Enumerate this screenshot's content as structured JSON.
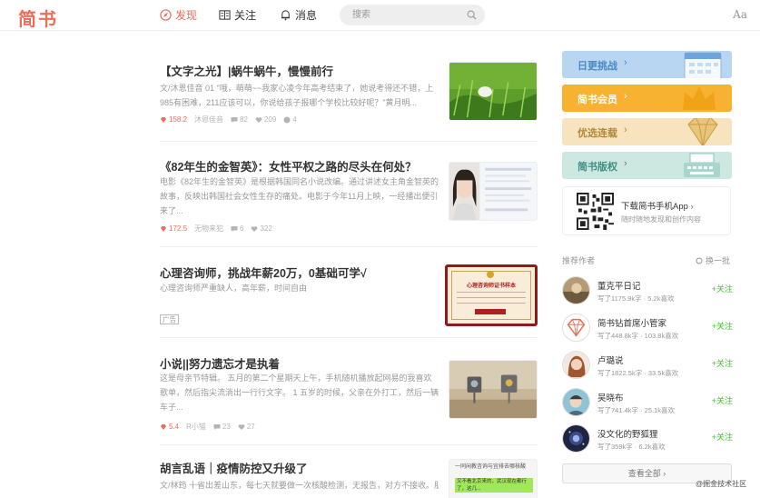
{
  "header": {
    "logo": "简书",
    "nav": [
      {
        "label": "发现"
      },
      {
        "label": "关注"
      },
      {
        "label": "消息"
      }
    ],
    "search_placeholder": "搜索",
    "aa_label": "Aa"
  },
  "articles": [
    {
      "title": "【文字之光】|蜗牛蜗牛，慢慢前行",
      "abstract": "文/沐恩佳音 01 \"哦，萌萌~~我家心凌今年高考结束了，她说考得还不错，上985有困难，211应该可以，你说给孩子报哪个学校比较好呢？\"黄月明...",
      "jsd": "158.2",
      "author": "沐恩佳音",
      "comments": "82",
      "likes": "209",
      "rewards": "4"
    },
    {
      "title": "《82年生的金智英》：女性平权之路的尽头在何处？",
      "abstract": "电影《82年生的金智英》是根据韩国同名小说改编。通过讲述女主角金智英的故事，反映出韩国社会女性生存的痛处。电影于今年11月上映，一经播出便引来了...",
      "jsd": "172.5",
      "author": "无物来犯",
      "comments": "6",
      "likes": "322"
    },
    {
      "title": "心理咨询师，挑战年薪20万，0基础可学√",
      "abstract": "心理咨询师严重缺人，高年薪，时间自由",
      "ad_tag": "广告",
      "cert_text": "心理咨询师证书样本"
    },
    {
      "title": "小说||努力遗忘才是执着",
      "abstract": "这是母亲节特辑。 五月的第二个星期天上午，手机随机播放起网易的我喜欢歌单，然后指尖流淌出一行行文字。 1 五岁的时候，父亲在外打工，然后一辆车子...",
      "jsd": "5.4",
      "author": "R小猫",
      "comments": "23",
      "likes": "27"
    },
    {
      "title": "胡言乱语｜疫情防控又升级了",
      "abstract": "文/林筠 十省出差山东，每七天就要做一次核酸检测，无报告，对方不接收。朋",
      "thumb_text_1": "一同闲教咨询与宜排去哪核酸",
      "thumb_text_2": "又不看北京来的，武汉现在都行了，这几..."
    }
  ],
  "sidebar": {
    "banners": [
      {
        "label": "日更挑战",
        "color": "#4a88c6"
      },
      {
        "label": "简书会员",
        "color": "#ffffff"
      },
      {
        "label": "优选连载",
        "color": "#b0883b"
      },
      {
        "label": "简书版权",
        "color": "#3e8f83"
      }
    ],
    "app_title": "下载简书手机App",
    "app_subtitle": "随时随地发现和创作内容",
    "recommended_title": "推荐作者",
    "refresh_label": "换一批",
    "authors": [
      {
        "name": "董克平日记",
        "stats": "写了1175.9k字 · 5.2k喜欢",
        "follow": "+关注"
      },
      {
        "name": "简书钻首席小管家",
        "stats": "写了448.8k字 · 103.8k喜欢",
        "follow": "+关注"
      },
      {
        "name": "卢璐说",
        "stats": "写了1822.5k字 · 33.5k喜欢",
        "follow": "+关注"
      },
      {
        "name": "吴晓布",
        "stats": "写了741.4k字 · 25.1k喜欢",
        "follow": "+关注"
      },
      {
        "name": "没文化的野狐狸",
        "stats": "写了359k字 · 6.2k喜欢",
        "follow": "+关注"
      }
    ],
    "view_all": "查看全部 ›"
  },
  "watermark": "@掘金技术社区",
  "colors": {
    "brand": "#ea6f5a",
    "follow": "#42c02e"
  }
}
